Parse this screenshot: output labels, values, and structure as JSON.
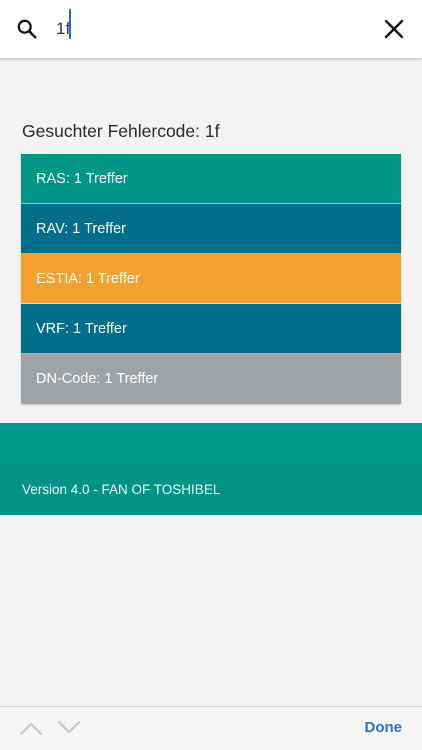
{
  "search": {
    "value": "1f",
    "icon": "search-icon",
    "close_icon": "close-icon"
  },
  "result": {
    "title": "Gesuchter Fehlercode: 1f",
    "items": [
      {
        "label": "RAS: 1 Treffer",
        "color": "#009688"
      },
      {
        "label": "RAV: 1 Treffer",
        "color": "#006e8a"
      },
      {
        "label": "ESTIA: 1 Treffer",
        "color": "#f4a030"
      },
      {
        "label": "VRF: 1 Treffer",
        "color": "#006e8a"
      },
      {
        "label": "DN-Code: 1 Treffer",
        "color": "#a0a3a6"
      }
    ]
  },
  "footer": {
    "version_text": "Version 4.0 - FAN OF TOSHIBEL",
    "band_color": "#009a8a"
  },
  "accessory": {
    "prev_icon": "chevron-up-icon",
    "next_icon": "chevron-down-icon",
    "done_label": "Done"
  }
}
